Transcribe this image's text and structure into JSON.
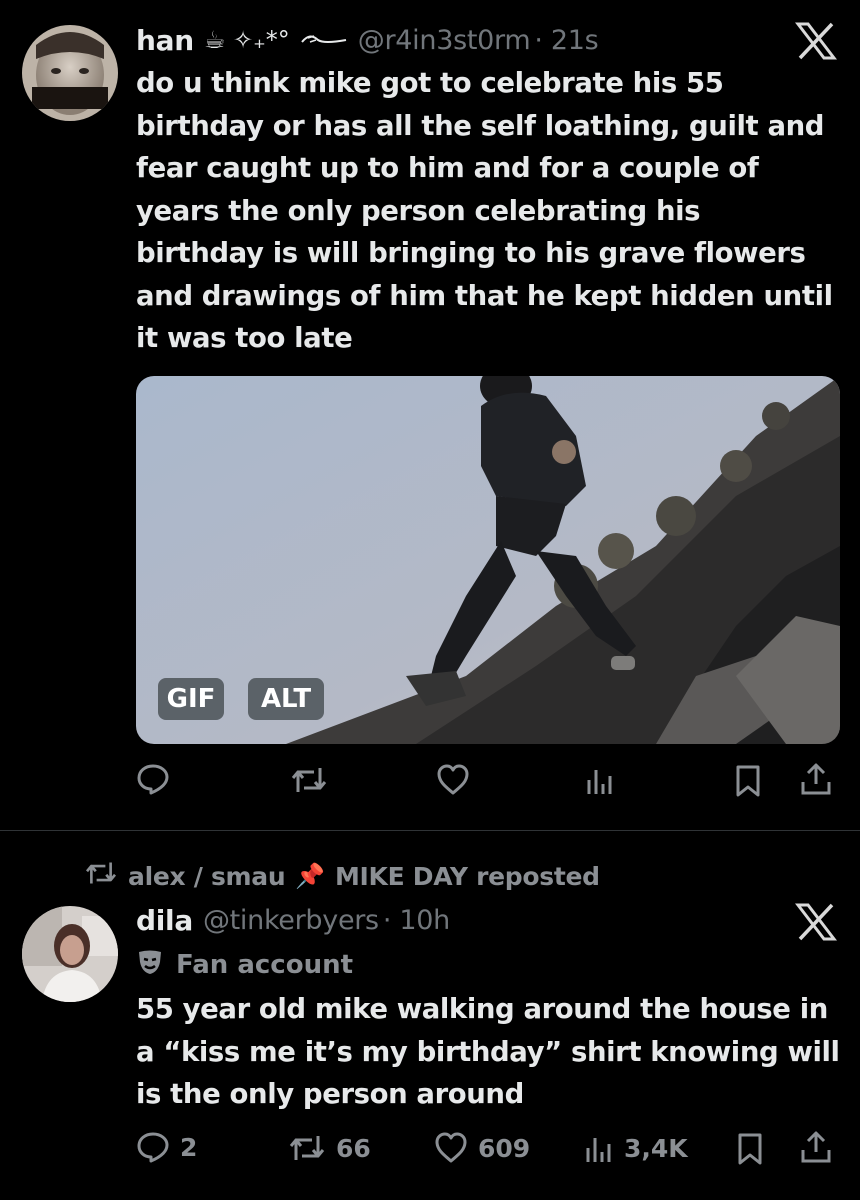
{
  "tweet1": {
    "name": "han",
    "name_decor": "☕ ✧₊*°",
    "handle": "@r4in3st0rm",
    "time": "· 21s",
    "text": "do u think mike got to celebrate his 55 birthday or has all the self loathing, guilt and fear caught up to him and for a couple of years the only person celebrating his birthday is will bringing to his grave flowers and drawings of him that he kept hidden until it was too late",
    "badges": {
      "gif": "GIF",
      "alt": "ALT"
    }
  },
  "repost": {
    "text": "alex / smau",
    "pin": "📌",
    "text2": "MIKE DAY reposted"
  },
  "tweet2": {
    "name": "dila",
    "handle": "@tinkerbyers",
    "time": "· 10h",
    "label": "Fan account",
    "text": "55 year old mike walking around the house in a “kiss me it’s my birthday” shirt knowing will is the only person around",
    "stats": {
      "replies": "2",
      "reposts": "66",
      "likes": "609",
      "views": "3,4K"
    }
  },
  "icons": [
    "x-logo-icon",
    "reply-icon",
    "repost-icon",
    "like-icon",
    "views-icon",
    "bookmark-icon",
    "share-icon",
    "theater-mask-icon",
    "pin-icon"
  ]
}
